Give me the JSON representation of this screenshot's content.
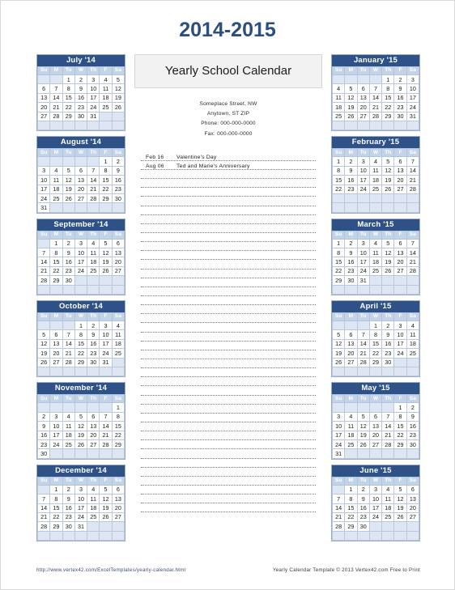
{
  "page": {
    "title": "2014-2015"
  },
  "center": {
    "heading": "Yearly School Calendar",
    "address": [
      "Someplace Street, NW",
      "Anytown, ST  ZIP",
      "Phone: 000-000-0000",
      "Fax: 000-000-0000"
    ],
    "notes": [
      {
        "date": "Feb 16",
        "text": "Valentine's Day"
      },
      {
        "date": "Aug 06",
        "text": "Ted and Marie's Anniversary"
      }
    ],
    "blank_line_count": 38
  },
  "weekday_headers": [
    "Su",
    "M",
    "Tu",
    "W",
    "Th",
    "F",
    "Sa"
  ],
  "colors": {
    "title": "#2b4f80",
    "month_header_bg": "#2e5288",
    "weekday_header_bg": "#c3d3e8",
    "blank_cell_bg": "#dde6f2",
    "grid_border": "#b8c8dd",
    "center_head_bg": "#f2f2f2"
  },
  "left_months": [
    {
      "name": "July '14",
      "weeks": [
        [
          "",
          "",
          "1",
          "2",
          "3",
          "4",
          "5"
        ],
        [
          "6",
          "7",
          "8",
          "9",
          "10",
          "11",
          "12"
        ],
        [
          "13",
          "14",
          "15",
          "16",
          "17",
          "18",
          "19"
        ],
        [
          "20",
          "21",
          "22",
          "23",
          "24",
          "25",
          "26"
        ],
        [
          "27",
          "28",
          "29",
          "30",
          "31",
          "",
          ""
        ],
        [
          "",
          "",
          "",
          "",
          "",
          "",
          ""
        ]
      ]
    },
    {
      "name": "August '14",
      "weeks": [
        [
          "",
          "",
          "",
          "",
          "",
          "1",
          "2"
        ],
        [
          "3",
          "4",
          "5",
          "6",
          "7",
          "8",
          "9"
        ],
        [
          "10",
          "11",
          "12",
          "13",
          "14",
          "15",
          "16"
        ],
        [
          "17",
          "18",
          "19",
          "20",
          "21",
          "22",
          "23"
        ],
        [
          "24",
          "25",
          "26",
          "27",
          "28",
          "29",
          "30"
        ],
        [
          "31",
          "",
          "",
          "",
          "",
          "",
          ""
        ]
      ]
    },
    {
      "name": "September '14",
      "weeks": [
        [
          "",
          "1",
          "2",
          "3",
          "4",
          "5",
          "6"
        ],
        [
          "7",
          "8",
          "9",
          "10",
          "11",
          "12",
          "13"
        ],
        [
          "14",
          "15",
          "16",
          "17",
          "18",
          "19",
          "20"
        ],
        [
          "21",
          "22",
          "23",
          "24",
          "25",
          "26",
          "27"
        ],
        [
          "28",
          "29",
          "30",
          "",
          "",
          "",
          ""
        ],
        [
          "",
          "",
          "",
          "",
          "",
          "",
          ""
        ]
      ]
    },
    {
      "name": "October '14",
      "weeks": [
        [
          "",
          "",
          "",
          "1",
          "2",
          "3",
          "4"
        ],
        [
          "5",
          "6",
          "7",
          "8",
          "9",
          "10",
          "11"
        ],
        [
          "12",
          "13",
          "14",
          "15",
          "16",
          "17",
          "18"
        ],
        [
          "19",
          "20",
          "21",
          "22",
          "23",
          "24",
          "25"
        ],
        [
          "26",
          "27",
          "28",
          "29",
          "30",
          "31",
          ""
        ],
        [
          "",
          "",
          "",
          "",
          "",
          "",
          ""
        ]
      ]
    },
    {
      "name": "November '14",
      "weeks": [
        [
          "",
          "",
          "",
          "",
          "",
          "",
          "1"
        ],
        [
          "2",
          "3",
          "4",
          "5",
          "6",
          "7",
          "8"
        ],
        [
          "9",
          "10",
          "11",
          "12",
          "13",
          "14",
          "15"
        ],
        [
          "16",
          "17",
          "18",
          "19",
          "20",
          "21",
          "22"
        ],
        [
          "23",
          "24",
          "25",
          "26",
          "27",
          "28",
          "29"
        ],
        [
          "30",
          "",
          "",
          "",
          "",
          "",
          ""
        ]
      ]
    },
    {
      "name": "December '14",
      "weeks": [
        [
          "",
          "1",
          "2",
          "3",
          "4",
          "5",
          "6"
        ],
        [
          "7",
          "8",
          "9",
          "10",
          "11",
          "12",
          "13"
        ],
        [
          "14",
          "15",
          "16",
          "17",
          "18",
          "19",
          "20"
        ],
        [
          "21",
          "22",
          "23",
          "24",
          "25",
          "26",
          "27"
        ],
        [
          "28",
          "29",
          "30",
          "31",
          "",
          "",
          ""
        ],
        [
          "",
          "",
          "",
          "",
          "",
          "",
          ""
        ]
      ]
    }
  ],
  "right_months": [
    {
      "name": "January '15",
      "weeks": [
        [
          "",
          "",
          "",
          "",
          "1",
          "2",
          "3"
        ],
        [
          "4",
          "5",
          "6",
          "7",
          "8",
          "9",
          "10"
        ],
        [
          "11",
          "12",
          "13",
          "14",
          "15",
          "16",
          "17"
        ],
        [
          "18",
          "19",
          "20",
          "21",
          "22",
          "23",
          "24"
        ],
        [
          "25",
          "26",
          "27",
          "28",
          "29",
          "30",
          "31"
        ],
        [
          "",
          "",
          "",
          "",
          "",
          "",
          ""
        ]
      ]
    },
    {
      "name": "February '15",
      "weeks": [
        [
          "1",
          "2",
          "3",
          "4",
          "5",
          "6",
          "7"
        ],
        [
          "8",
          "9",
          "10",
          "11",
          "12",
          "13",
          "14"
        ],
        [
          "15",
          "16",
          "17",
          "18",
          "19",
          "20",
          "21"
        ],
        [
          "22",
          "23",
          "24",
          "25",
          "26",
          "27",
          "28"
        ],
        [
          "",
          "",
          "",
          "",
          "",
          "",
          ""
        ],
        [
          "",
          "",
          "",
          "",
          "",
          "",
          ""
        ]
      ]
    },
    {
      "name": "March '15",
      "weeks": [
        [
          "1",
          "2",
          "3",
          "4",
          "5",
          "6",
          "7"
        ],
        [
          "8",
          "9",
          "10",
          "11",
          "12",
          "13",
          "14"
        ],
        [
          "15",
          "16",
          "17",
          "18",
          "19",
          "20",
          "21"
        ],
        [
          "22",
          "23",
          "24",
          "25",
          "26",
          "27",
          "28"
        ],
        [
          "29",
          "30",
          "31",
          "",
          "",
          "",
          ""
        ],
        [
          "",
          "",
          "",
          "",
          "",
          "",
          ""
        ]
      ]
    },
    {
      "name": "April '15",
      "weeks": [
        [
          "",
          "",
          "",
          "1",
          "2",
          "3",
          "4"
        ],
        [
          "5",
          "6",
          "7",
          "8",
          "9",
          "10",
          "11"
        ],
        [
          "12",
          "13",
          "14",
          "15",
          "16",
          "17",
          "18"
        ],
        [
          "19",
          "20",
          "21",
          "22",
          "23",
          "24",
          "25"
        ],
        [
          "26",
          "27",
          "28",
          "29",
          "30",
          "",
          ""
        ],
        [
          "",
          "",
          "",
          "",
          "",
          "",
          ""
        ]
      ]
    },
    {
      "name": "May '15",
      "weeks": [
        [
          "",
          "",
          "",
          "",
          "",
          "1",
          "2"
        ],
        [
          "3",
          "4",
          "5",
          "6",
          "7",
          "8",
          "9"
        ],
        [
          "10",
          "11",
          "12",
          "13",
          "14",
          "15",
          "16"
        ],
        [
          "17",
          "18",
          "19",
          "20",
          "21",
          "22",
          "23"
        ],
        [
          "24",
          "25",
          "26",
          "27",
          "28",
          "29",
          "30"
        ],
        [
          "31",
          "",
          "",
          "",
          "",
          "",
          ""
        ]
      ]
    },
    {
      "name": "June '15",
      "weeks": [
        [
          "",
          "1",
          "2",
          "3",
          "4",
          "5",
          "6"
        ],
        [
          "7",
          "8",
          "9",
          "10",
          "11",
          "12",
          "13"
        ],
        [
          "14",
          "15",
          "16",
          "17",
          "18",
          "19",
          "20"
        ],
        [
          "21",
          "22",
          "23",
          "24",
          "25",
          "26",
          "27"
        ],
        [
          "28",
          "29",
          "30",
          "",
          "",
          "",
          ""
        ],
        [
          "",
          "",
          "",
          "",
          "",
          "",
          ""
        ]
      ]
    }
  ],
  "footer": {
    "url": "http://www.vertex42.com/ExcelTemplates/yearly-calendar.html",
    "credit": "Yearly Calendar Template © 2013 Vertex42.com  Free to Print"
  }
}
